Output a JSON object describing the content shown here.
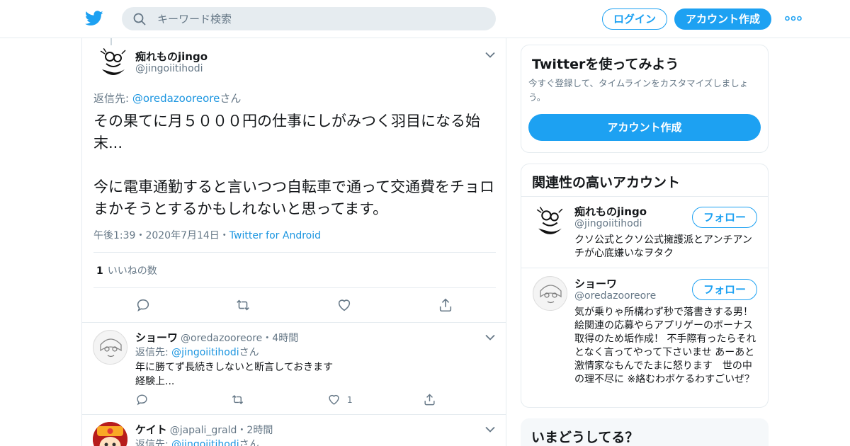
{
  "header": {
    "search_placeholder": "キーワード検索",
    "login_label": "ログイン",
    "signup_label": "アカウント作成",
    "accent_color": "#1da1f2"
  },
  "main_tweet": {
    "name": "痴れものjingo",
    "handle": "@jingoiitihodi",
    "reply_label": "返信先: ",
    "reply_handle": "@oredazooreore",
    "reply_suffix": "さん",
    "text": "その果てに月５０００円の仕事にしがみつく羽目になる始末...\n\n今に電車通勤すると言いつつ自転車で通って交通費をチョロまかそうとするかもしれないと思ってます。",
    "timestamp": "午後1:39・2020年7月14日・",
    "source": "Twitter for Android",
    "like_count": "1",
    "like_label": "いいねの数"
  },
  "replies": [
    {
      "name": "ショーワ",
      "handle": "@oredazooreore",
      "time": "・4時間",
      "reply_label": "返信先: ",
      "reply_handle": "@jingoiitihodi",
      "reply_suffix": "さん",
      "line1": "年に勝てず長続きしないと断言しておきます",
      "line2": "経験上...",
      "like_count": "1"
    },
    {
      "name": "ケイト",
      "handle": "@japali_grald",
      "time": "・2時間",
      "reply_label": "返信先: ",
      "reply_handle": "@jingoiitihodi",
      "reply_suffix": "さん"
    }
  ],
  "sidebar": {
    "signup_card": {
      "title": "Twitterを使ってみよう",
      "subtitle": "今すぐ登録して、タイムラインをカスタマイズしましょう。",
      "button": "アカウント作成"
    },
    "related": {
      "title": "関連性の高いアカウント",
      "follow_label": "フォロー",
      "accounts": [
        {
          "name": "痴れものjingo",
          "handle": "@jingoiitihodi",
          "bio": "クソ公式とクソ公式擁護派とアンチアンチが心底嫌いなヲタク"
        },
        {
          "name": "ショーワ",
          "handle": "@oredazooreore",
          "bio": "気が乗りゃ所構わず秒で落書きする男！ 絵関連の応募やらアプリゲーのボーナス取得のため垢作成！ 不手際有ったらそれとなく言ってやって下さいませ あーあと激情家なもんでたまに怒ります　世の中の理不尽に ※絡むわボケるわすごいぜ？"
        }
      ]
    },
    "whats_happening": {
      "title": "いまどうしてる？"
    }
  }
}
